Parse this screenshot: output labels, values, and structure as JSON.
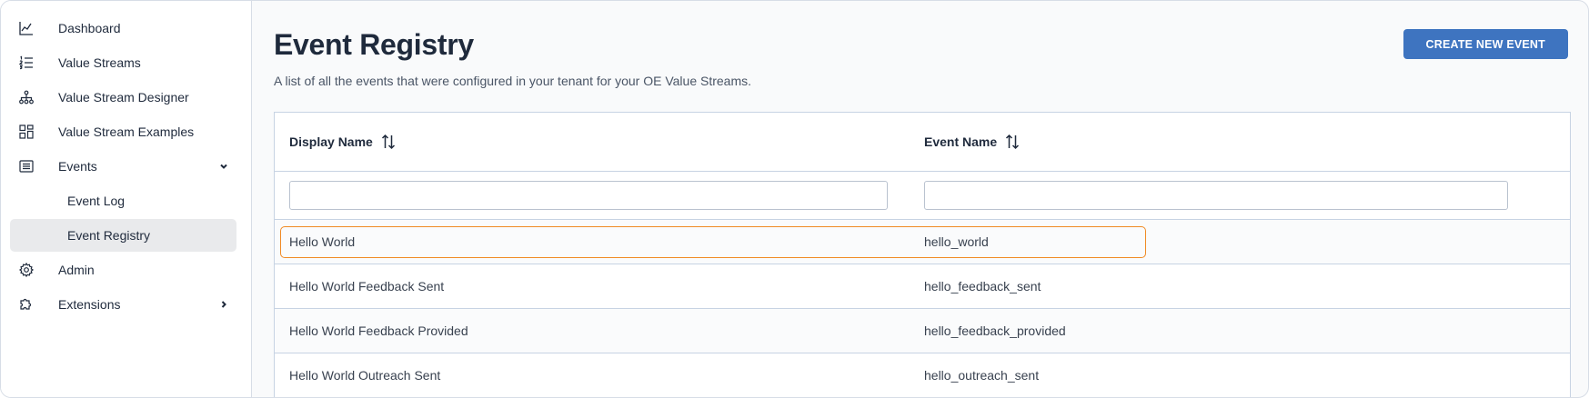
{
  "sidebar": {
    "items": [
      {
        "label": "Dashboard",
        "icon": "chart-line-icon"
      },
      {
        "label": "Value Streams",
        "icon": "list-numbered-icon"
      },
      {
        "label": "Value Stream Designer",
        "icon": "sitemap-icon"
      },
      {
        "label": "Value Stream Examples",
        "icon": "grid-icon"
      },
      {
        "label": "Events",
        "icon": "list-box-icon",
        "expanded": true
      },
      {
        "label": "Event Log",
        "sub": true
      },
      {
        "label": "Event Registry",
        "sub": true,
        "active": true
      },
      {
        "label": "Admin",
        "icon": "gear-icon"
      },
      {
        "label": "Extensions",
        "icon": "puzzle-icon",
        "expanded": false
      }
    ]
  },
  "header": {
    "title": "Event Registry",
    "subtitle": "A list of all the events that were configured in your tenant for your OE Value Streams.",
    "create_label": "CREATE NEW EVENT"
  },
  "table": {
    "columns": [
      "Display Name",
      "Event Name"
    ],
    "filters": [
      "",
      ""
    ],
    "rows": [
      {
        "display_name": "Hello World",
        "event_name": "hello_world",
        "highlighted": true
      },
      {
        "display_name": "Hello World Feedback Sent",
        "event_name": "hello_feedback_sent"
      },
      {
        "display_name": "Hello World Feedback Provided",
        "event_name": "hello_feedback_provided"
      },
      {
        "display_name": "Hello World Outreach Sent",
        "event_name": "hello_outreach_sent"
      }
    ]
  },
  "colors": {
    "accent": "#3e74c0",
    "highlight": "#f08a24",
    "active_nav": "#e9eaec"
  }
}
